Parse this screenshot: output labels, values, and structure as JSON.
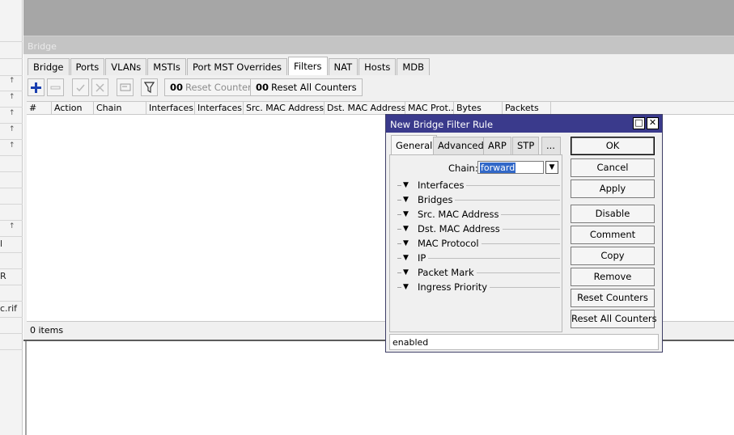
{
  "sidebar": {
    "marks": [
      "l",
      "R",
      "c.rif"
    ],
    "arrow": "↑"
  },
  "bridge": {
    "title": "Bridge",
    "tabs": [
      {
        "label": "Bridge"
      },
      {
        "label": "Ports"
      },
      {
        "label": "VLANs"
      },
      {
        "label": "MSTIs"
      },
      {
        "label": "Port MST Overrides"
      },
      {
        "label": "Filters",
        "active": true
      },
      {
        "label": "NAT"
      },
      {
        "label": "Hosts"
      },
      {
        "label": "MDB"
      }
    ],
    "toolbar": {
      "add_icon": "plus-icon",
      "remove_icon": "minus-icon",
      "enable_icon": "check-icon",
      "disable_icon": "x-icon",
      "comment_icon": "comment-icon",
      "filter_icon": "funnel-icon",
      "reset_counters_prefix": "00",
      "reset_counters": "Reset Counters",
      "reset_all_counters_prefix": "00",
      "reset_all_counters": "Reset All Counters"
    },
    "columns": [
      "#",
      "Action",
      "Chain",
      "Interfaces...",
      "Interfaces...",
      "Src. MAC Address...",
      "Dst. MAC Address...",
      "MAC Prot...",
      "Bytes",
      "Packets"
    ],
    "status": "0 items"
  },
  "dialog": {
    "title": "New Bridge Filter Rule",
    "maximize_glyph": "□",
    "close_glyph": "✕",
    "tabs": [
      {
        "label": "General",
        "active": true
      },
      {
        "label": "Advanced"
      },
      {
        "label": "ARP"
      },
      {
        "label": "STP"
      },
      {
        "label": "..."
      }
    ],
    "chain_label": "Chain:",
    "chain_value": "forward",
    "sections": [
      "Interfaces",
      "Bridges",
      "Src. MAC Address",
      "Dst. MAC Address",
      "MAC Protocol",
      "IP",
      "Packet Mark",
      "Ingress Priority"
    ],
    "buttons": [
      {
        "label": "OK",
        "default": true
      },
      {
        "label": "Cancel"
      },
      {
        "label": "Apply"
      },
      {
        "label": "Disable"
      },
      {
        "label": "Comment"
      },
      {
        "label": "Copy"
      },
      {
        "label": "Remove"
      },
      {
        "label": "Reset Counters"
      },
      {
        "label": "Reset All Counters"
      }
    ],
    "status": "enabled"
  },
  "colors": {
    "dialog_title_bg": "#3a3a8c",
    "add_icon": "#1a3fb0",
    "selection": "#3168c8"
  }
}
